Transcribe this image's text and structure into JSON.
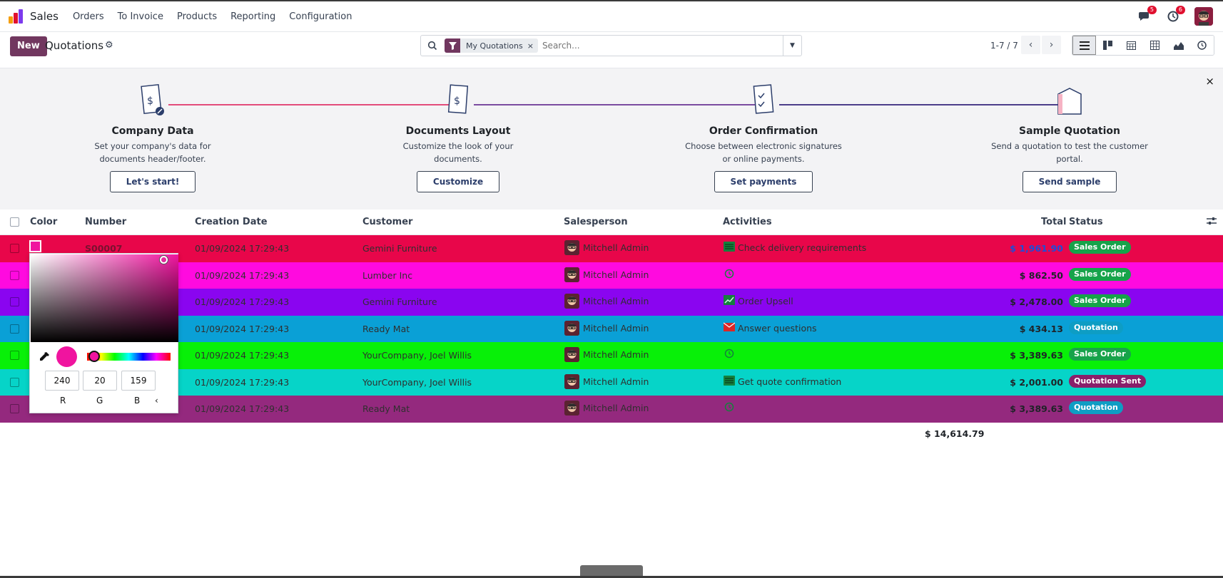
{
  "navbar": {
    "brand": "Sales",
    "menu": [
      "Orders",
      "To Invoice",
      "Products",
      "Reporting",
      "Configuration"
    ],
    "messages_badge": "5",
    "activities_badge": "6"
  },
  "control": {
    "new_label": "New",
    "title": "Quotations",
    "facet_label": "My Quotations",
    "facet_close": "×",
    "search_placeholder": "Search...",
    "pager": "1-7 / 7"
  },
  "onboarding": {
    "close": "×",
    "steps": [
      {
        "title": "Company Data",
        "desc": "Set your company's data for documents header/footer.",
        "button": "Let's start!"
      },
      {
        "title": "Documents Layout",
        "desc": "Customize the look of your documents.",
        "button": "Customize"
      },
      {
        "title": "Order Confirmation",
        "desc": "Choose between electronic signatures or online payments.",
        "button": "Set payments"
      },
      {
        "title": "Sample Quotation",
        "desc": "Send a quotation to test the customer portal.",
        "button": "Send sample"
      }
    ]
  },
  "table": {
    "headers": {
      "color": "Color",
      "number": "Number",
      "date": "Creation Date",
      "customer": "Customer",
      "salesperson": "Salesperson",
      "activities": "Activities",
      "total": "Total",
      "status": "Status"
    },
    "rows": [
      {
        "bg": "#e8064a",
        "number": "S00007",
        "date": "01/09/2024 17:29:43",
        "customer": "Gemini Furniture",
        "salesperson": "Mitchell Admin",
        "activity": "Check delivery requirements",
        "activity_icon": "list-icon",
        "total": "$ 1,961.90",
        "status": "Sales Order",
        "status_color": "#16a34a"
      },
      {
        "bg": "#ff0adf",
        "number": "",
        "date": "01/09/2024 17:29:43",
        "customer": "Lumber Inc",
        "salesperson": "Mitchell Admin",
        "activity": "",
        "activity_icon": "clock-icon",
        "total": "$ 862.50",
        "status": "Sales Order",
        "status_color": "#16a34a"
      },
      {
        "bg": "#8a05f0",
        "number": "",
        "date": "01/09/2024 17:29:43",
        "customer": "Gemini Furniture",
        "salesperson": "Mitchell Admin",
        "activity": "Order Upsell",
        "activity_icon": "chart-icon",
        "total": "$ 2,478.00",
        "status": "Sales Order",
        "status_color": "#16a34a"
      },
      {
        "bg": "#0aa0d6",
        "number": "",
        "date": "01/09/2024 17:29:43",
        "customer": "Ready Mat",
        "salesperson": "Mitchell Admin",
        "activity": "Answer questions",
        "activity_icon": "envelope-icon",
        "total": "$ 434.13",
        "status": "Quotation",
        "status_color": "#0e9dc4"
      },
      {
        "bg": "#08f008",
        "number": "",
        "date": "01/09/2024 17:29:43",
        "customer": "YourCompany, Joel Willis",
        "salesperson": "Mitchell Admin",
        "activity": "",
        "activity_icon": "clock-icon",
        "total": "$ 3,389.63",
        "status": "Sales Order",
        "status_color": "#16a34a"
      },
      {
        "bg": "#06d4c8",
        "number": "",
        "date": "01/09/2024 17:29:43",
        "customer": "YourCompany, Joel Willis",
        "salesperson": "Mitchell Admin",
        "activity": "Get quote confirmation",
        "activity_icon": "list-icon",
        "total": "$ 2,001.00",
        "status": "Quotation Sent",
        "status_color": "#8a1f6a"
      },
      {
        "bg": "#94297e",
        "number": "",
        "date": "01/09/2024 17:29:43",
        "customer": "Ready Mat",
        "salesperson": "Mitchell Admin",
        "activity": "",
        "activity_icon": "clock-icon",
        "total": "$ 3,389.63",
        "status": "Quotation",
        "status_color": "#0e9dc4"
      }
    ],
    "grand_total": "$ 14,614.79"
  },
  "picker": {
    "r": "240",
    "g": "20",
    "b": "159",
    "r_label": "R",
    "g_label": "G",
    "b_label": "B",
    "mode_toggle": "‹",
    "color": "#f0149f"
  }
}
